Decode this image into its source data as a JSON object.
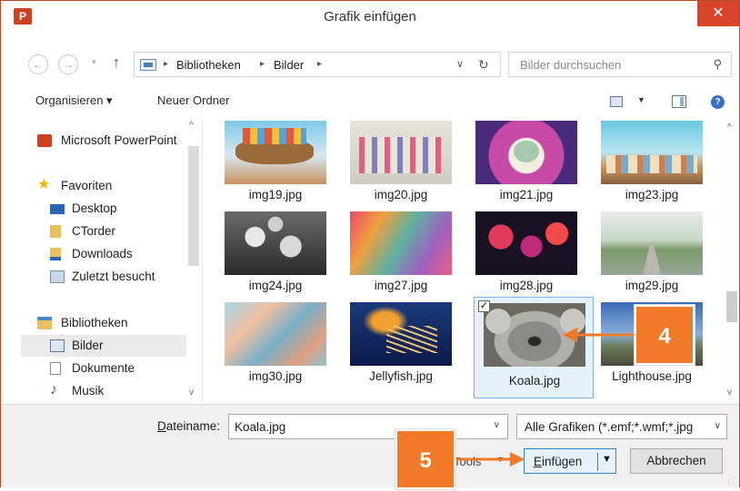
{
  "window": {
    "title": "Grafik einfügen",
    "app_icon": "P",
    "close": "✕"
  },
  "nav": {
    "back": "←",
    "forward": "→",
    "up": "↑"
  },
  "address": {
    "crumbs": [
      "Bibliotheken",
      "Bilder"
    ],
    "refresh": "↻",
    "search_placeholder": "Bilder durchsuchen"
  },
  "toolbar": {
    "organize": "Organisieren ▾",
    "new_folder": "Neuer Ordner",
    "help": "?"
  },
  "sidebar": {
    "powerpoint": "Microsoft PowerPoint",
    "favorites": "Favoriten",
    "desktop": "Desktop",
    "ctorder": "CTorder",
    "downloads": "Downloads",
    "recent": "Zuletzt besucht",
    "libraries": "Bibliotheken",
    "pictures": "Bilder",
    "documents": "Dokumente",
    "music": "Musik"
  },
  "files": [
    {
      "name": "img19.jpg"
    },
    {
      "name": "img20.jpg"
    },
    {
      "name": "img21.jpg"
    },
    {
      "name": "img23.jpg"
    },
    {
      "name": "img24.jpg"
    },
    {
      "name": "img27.jpg"
    },
    {
      "name": "img28.jpg"
    },
    {
      "name": "img29.jpg"
    },
    {
      "name": "img30.jpg"
    },
    {
      "name": "Jellyfish.jpg"
    },
    {
      "name": "Koala.jpg",
      "selected": true
    },
    {
      "name": "Lighthouse.jpg"
    }
  ],
  "bottom": {
    "filename_label_u": "D",
    "filename_label_rest": "ateiname:",
    "filename_value": "Koala.jpg",
    "filter": "Alle Grafiken (*.emf;*.wmf;*.jpg",
    "tools": "Tools",
    "insert_u": "E",
    "insert_rest": "infügen",
    "cancel": "Abbrechen"
  },
  "annotations": {
    "badge4": "4",
    "badge5": "5",
    "accent": "#f07a2a"
  }
}
